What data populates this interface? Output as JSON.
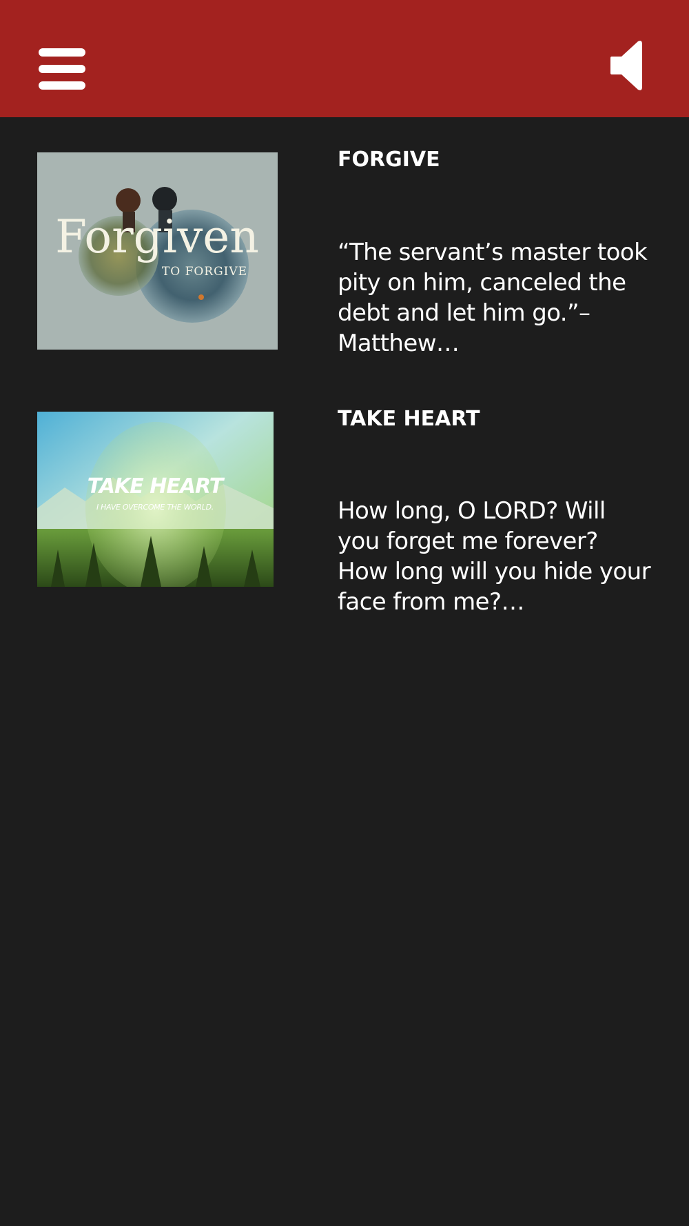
{
  "header": {
    "menu_icon": "hamburger-menu-icon",
    "sound_icon": "speaker-icon",
    "bar_color": "#a3221f"
  },
  "background_color": "#1d1d1d",
  "sermons": [
    {
      "title": "FORGIVE",
      "excerpt": "“The servant’s master took pity on him, canceled the debt and let him go.”–Matthew…",
      "thumbnail": {
        "main_text": "Forgiven",
        "sub_text": "TO FORGIVE"
      }
    },
    {
      "title": "TAKE HEART",
      "excerpt": "How long, O LORD? Will you forget me forever? How long will you hide your face from me?…",
      "thumbnail": {
        "main_text": "TAKE HEART",
        "sub_text": "I HAVE OVERCOME THE WORLD."
      }
    }
  ]
}
